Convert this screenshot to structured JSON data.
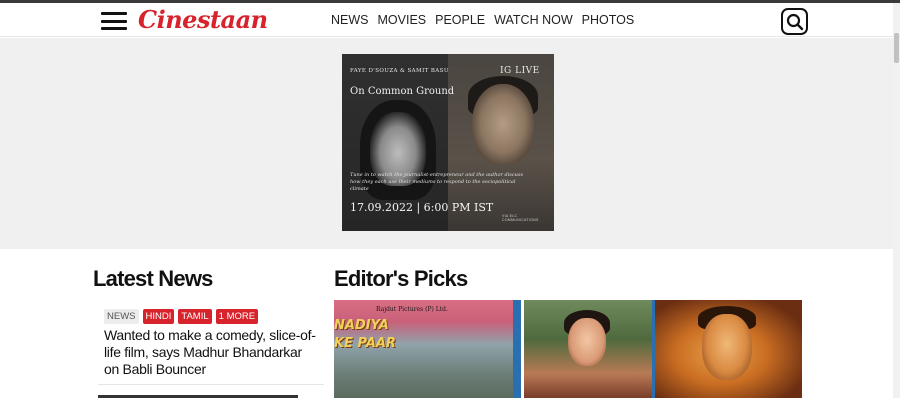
{
  "brand": {
    "logo_text": "Cinestaan",
    "accent_color": "#d6232c"
  },
  "nav": {
    "items": [
      {
        "label": "NEWS"
      },
      {
        "label": "MOVIES"
      },
      {
        "label": "PEOPLE"
      },
      {
        "label": "WATCH NOW"
      },
      {
        "label": "PHOTOS"
      }
    ]
  },
  "icons": {
    "menu": "hamburger-menu-icon",
    "search": "search-icon"
  },
  "banner": {
    "names": "FAYE D'SOUZA & SAMIT BASU",
    "badge": "IG LIVE",
    "title": "On Common Ground",
    "description": "Tune in to watch the journalist-entrepreneur and the author discuss how they each use their mediums to respond to the sociopolitical climate",
    "date_time": "17.09.2022 | 6:00 PM IST",
    "credit": "VIA ELC COMMUNICATIONS"
  },
  "latest_news": {
    "heading": "Latest News",
    "items": [
      {
        "tags": [
          {
            "label": "NEWS",
            "style": "plain"
          },
          {
            "label": "HINDI",
            "style": "red"
          },
          {
            "label": "TAMIL",
            "style": "red"
          },
          {
            "label": "1 MORE",
            "style": "red"
          }
        ],
        "headline": "Wanted to make a comedy, slice-of-life film, says Madhur Bhandarkar on Babli Bouncer"
      }
    ]
  },
  "editors_picks": {
    "heading": "Editor's Picks",
    "items": [
      {
        "poster_text_publisher": "Rajdut Pictures (P) Ltd.",
        "poster_title_line1": "NADIYA",
        "poster_title_line2": "KE PAAR"
      },
      {
        "poster_text_publisher": ""
      }
    ]
  }
}
